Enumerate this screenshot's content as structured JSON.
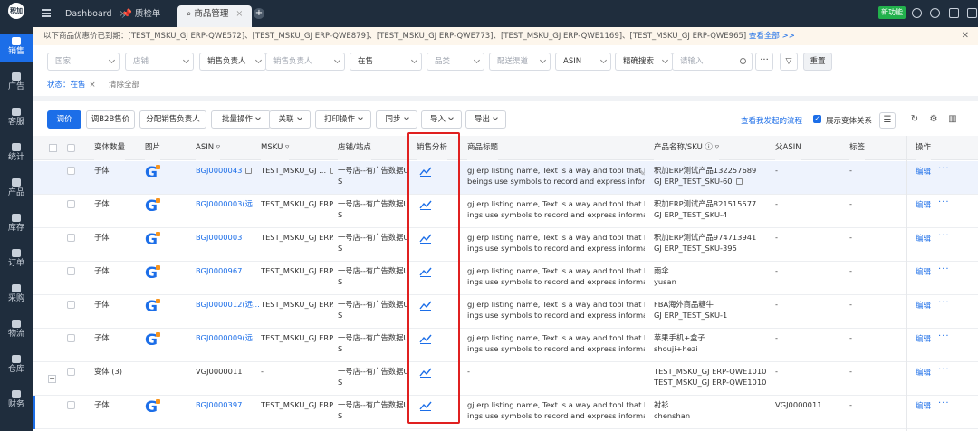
{
  "sidebar": {
    "logo": "积加",
    "items": [
      {
        "label": "销售",
        "active": true
      },
      {
        "label": "广告"
      },
      {
        "label": "客服"
      },
      {
        "label": "统计"
      },
      {
        "label": "产品"
      },
      {
        "label": "库存"
      },
      {
        "label": "订单"
      },
      {
        "label": "采购"
      },
      {
        "label": "物流"
      },
      {
        "label": "仓库"
      },
      {
        "label": "财务"
      }
    ]
  },
  "topbar": {
    "tabs": [
      {
        "label": "Dashboard"
      },
      {
        "label": "质检单"
      },
      {
        "label": "商品管理",
        "active": true
      }
    ],
    "new_label": "新功能"
  },
  "notice": {
    "text": "以下商品优惠价已到期：[TEST_MSKU_GJ ERP-QWE572]、[TEST_MSKU_GJ ERP-QWE879]、[TEST_MSKU_GJ ERP-QWE773]、[TEST_MSKU_GJ ERP-QWE1169]、[TEST_MSKU_GJ ERP-QWE965]",
    "link": "查看全部 >>"
  },
  "filters": {
    "country": "国家",
    "shop": "店铺",
    "owner_type": "销售负责人",
    "owner_placeholder": "销售负责人",
    "status": "在售",
    "category": "品类",
    "channel": "配送渠道",
    "id_type": "ASIN",
    "search_mode": "精确搜索",
    "search_placeholder": "请输入",
    "more": "···",
    "reset": "重置",
    "active_chip": "状态：在售",
    "clear_all": "清除全部"
  },
  "actions": {
    "buttons": [
      "调价",
      "调B2B售价",
      "分配销售负责人",
      "批量操作",
      "关联",
      "打印操作",
      "同步",
      "导入",
      "导出"
    ],
    "flow_link": "查看我发起的流程",
    "show_variants": "展示变体关系"
  },
  "table": {
    "headers": [
      "变体数量",
      "图片",
      "ASIN",
      "MSKU",
      "店铺/站点",
      "销售分析",
      "商品标题",
      "产品名称/SKU",
      "父ASIN",
      "标签",
      "操作"
    ],
    "edit_label": "编辑",
    "more_label": "···",
    "rows": [
      {
        "variant": "子体",
        "asin": "BGJ0000043",
        "msku": "TEST_MSKU_GJ ...",
        "shop1": "一号店--有广告数据U",
        "shop2": "S",
        "title1": "gj erp listing name, Text is a way and tool that human",
        "title2": "beings use symbols to record and express informatio...",
        "pname": "积加ERP测试产品132257689",
        "psku": "GJ ERP_TEST_SKU-60",
        "parent": "-",
        "tag": "-",
        "hl": true
      },
      {
        "variant": "子体",
        "asin": "BGJ0000003(远...",
        "msku": "TEST_MSKU_GJ ERP...",
        "shop1": "一号店--有广告数据U",
        "shop2": "S",
        "title1": "gj erp listing name, Text is a way and tool that human be",
        "title2": "ings use symbols to record and express information fo...",
        "pname": "积加ERP测试产品821515577",
        "psku": "GJ ERP_TEST_SKU-4",
        "parent": "-",
        "tag": "-"
      },
      {
        "variant": "子体",
        "asin": "BGJ0000003",
        "msku": "TEST_MSKU_GJ ERP...",
        "shop1": "一号店--有广告数据U",
        "shop2": "S",
        "title1": "gj erp listing name, Text is a way and tool that human be",
        "title2": "ings use symbols to record and express information fo...",
        "pname": "积加ERP测试产品974713941",
        "psku": "GJ ERP_TEST_SKU-395",
        "parent": "-",
        "tag": "-"
      },
      {
        "variant": "子体",
        "asin": "BGJ0000967",
        "msku": "TEST_MSKU_GJ ERP...",
        "shop1": "一号店--有广告数据U",
        "shop2": "S",
        "title1": "gj erp listing name, Text is a way and tool that human be",
        "title2": "ings use symbols to record and express information fo...",
        "pname": "雨伞",
        "psku": "yusan",
        "parent": "-",
        "tag": "-"
      },
      {
        "variant": "子体",
        "asin": "BGJ0000012(远...",
        "msku": "TEST_MSKU_GJ ERP...",
        "shop1": "一号店--有广告数据U",
        "shop2": "S",
        "title1": "gj erp listing name, Text is a way and tool that human be",
        "title2": "ings use symbols to record and express information fo...",
        "pname": "FBA海外商品糖牛",
        "psku": "GJ ERP_TEST_SKU-1",
        "parent": "-",
        "tag": "-"
      },
      {
        "variant": "子体",
        "asin": "BGJ0000009(远...",
        "msku": "TEST_MSKU_GJ ERP...",
        "shop1": "一号店--有广告数据U",
        "shop2": "S",
        "title1": "gj erp listing name, Text is a way and tool that human be",
        "title2": "ings use symbols to record and express information fo...",
        "pname": "苹果手机+盒子",
        "psku": "shouji+hezi",
        "parent": "-",
        "tag": "-"
      },
      {
        "variant": "变体 (3)",
        "asin": "VGJ0000011",
        "msku": "-",
        "shop1": "一号店--有广告数据U",
        "shop2": "S",
        "title1": "-",
        "title2": "",
        "pname": "TEST_MSKU_GJ ERP-QWE1010",
        "psku": "TEST_MSKU_GJ ERP-QWE1010",
        "parent": "-",
        "tag": "-",
        "parentRow": true
      },
      {
        "variant": "子体",
        "asin": "BGJ0000397",
        "msku": "TEST_MSKU_GJ ERP...",
        "shop1": "一号店--有广告数据U",
        "shop2": "S",
        "title1": "gj erp listing name, Text is a way and tool that human be",
        "title2": "ings use symbols to record and express information fo...",
        "pname": "衬衫",
        "psku": "chenshan",
        "parent": "VGJ0000011",
        "tag": "-",
        "bar": true
      }
    ]
  }
}
